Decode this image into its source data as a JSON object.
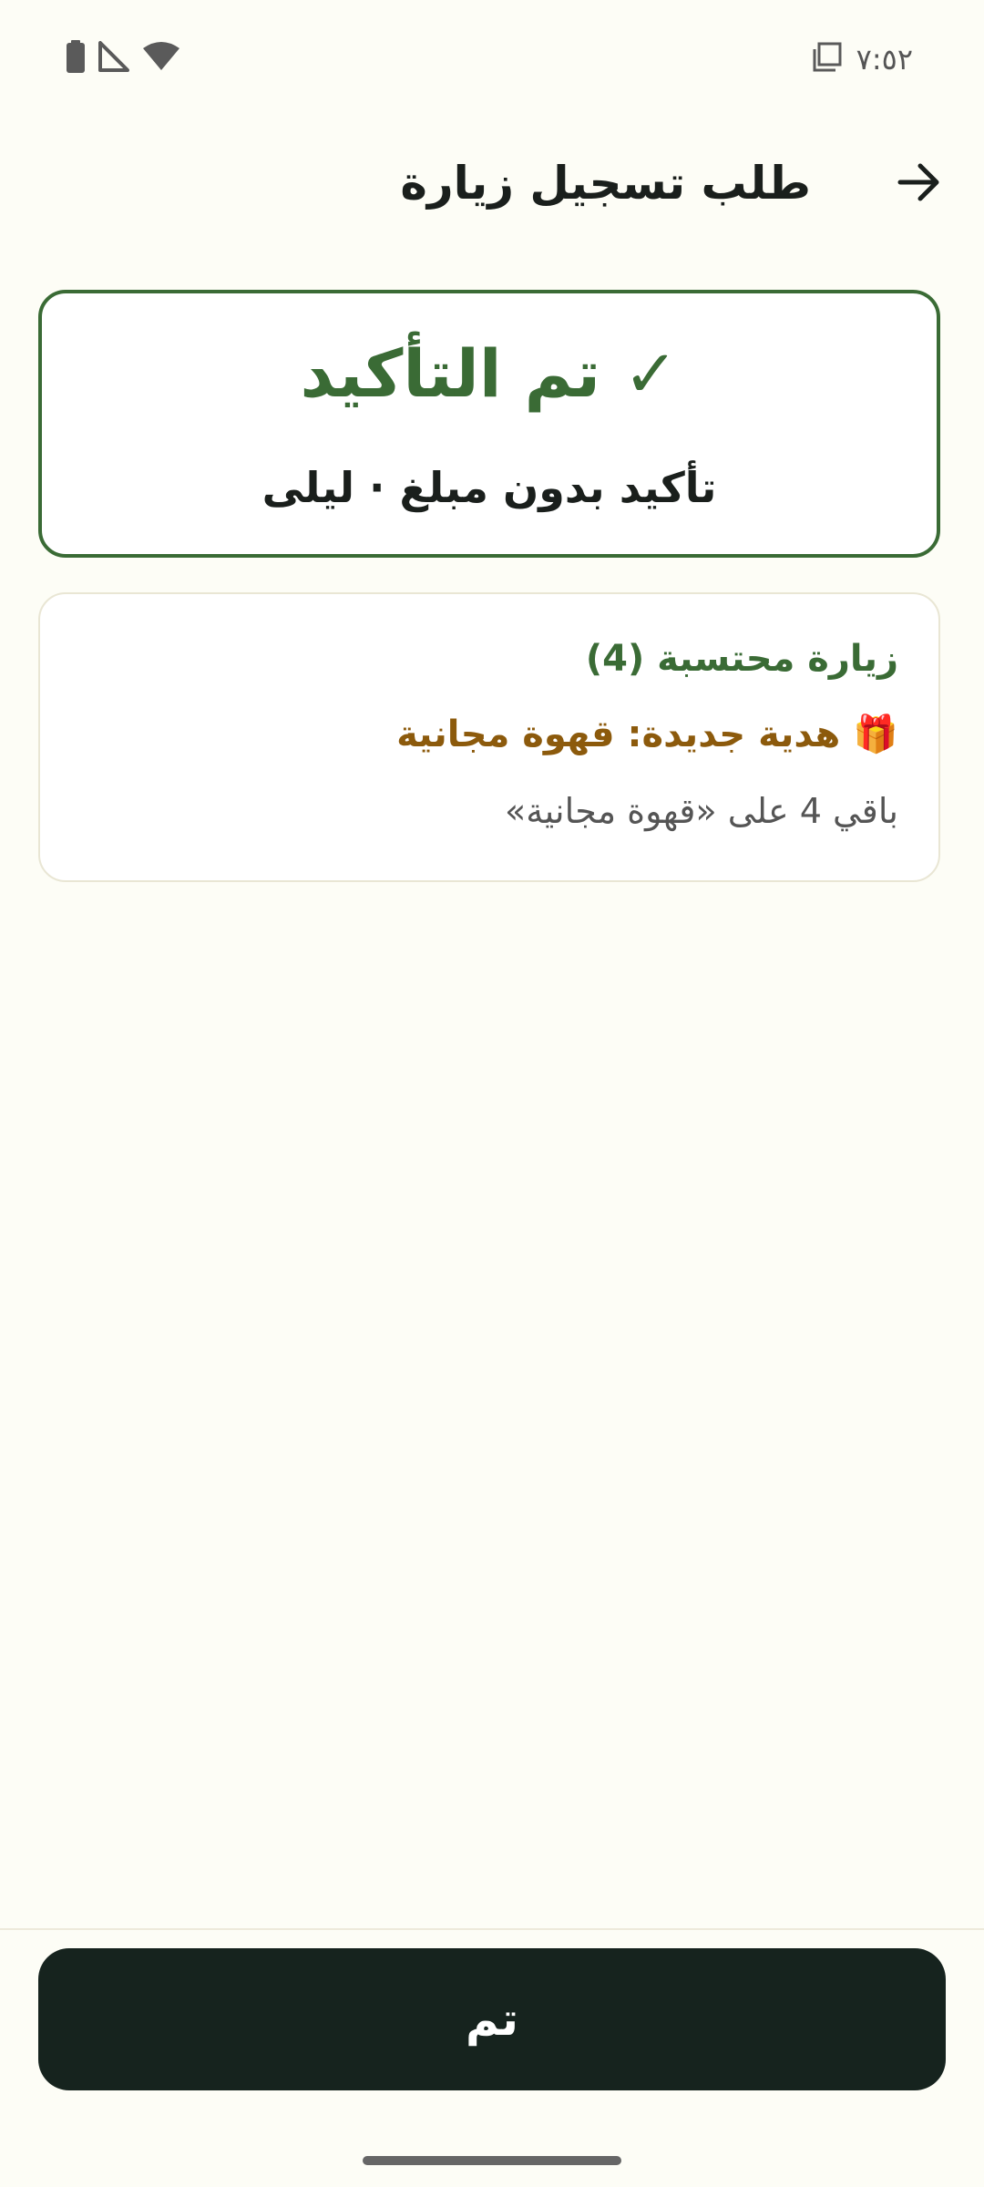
{
  "status_bar": {
    "time": "٧:٥٢",
    "icons": [
      "battery-icon",
      "signal-icon",
      "wifi-icon",
      "screenshot-icon"
    ]
  },
  "app_bar": {
    "title": "طلب تسجيل زيارة",
    "back_icon": "arrow-back-icon"
  },
  "confirmation": {
    "title": "✓ تم التأكيد",
    "subtitle": "تأكيد بدون مبلغ · ليلى",
    "accent_color": "#3a6b35"
  },
  "details": {
    "visit_counted": "زيارة محتسبة (4)",
    "reward_emoji": "🎁",
    "reward_text": "هدية جديدة: قهوة مجانية",
    "remaining": "باقي 4 على «قهوة مجانية»",
    "reward_color": "#8c5a0c"
  },
  "footer": {
    "done_label": "تم",
    "button_color": "#16231e"
  }
}
